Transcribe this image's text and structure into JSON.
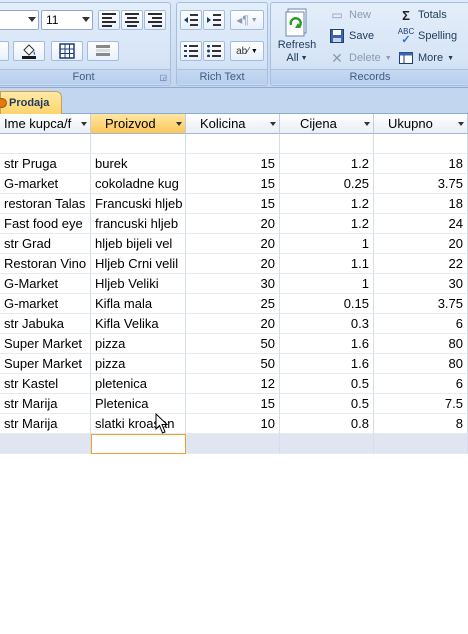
{
  "ribbon": {
    "font_group": {
      "label": "Font",
      "font_size": "11"
    },
    "rich_text_group": {
      "label": "Rich Text"
    },
    "records_group": {
      "label": "Records",
      "refresh_label_line1": "Refresh",
      "refresh_label_line2": "All",
      "new_label": "New",
      "save_label": "Save",
      "delete_label": "Delete",
      "totals_label": "Totals",
      "spelling_label": "Spelling",
      "more_label": "More"
    }
  },
  "tab": {
    "label": "Prodaja"
  },
  "table": {
    "columns": [
      "Ime kupca/f",
      "Proizvod",
      "Kolicina",
      "Cijena",
      "Ukupno"
    ],
    "rows": [
      [
        "str Pruga",
        "burek",
        "15",
        "1.2",
        "18"
      ],
      [
        "G-market",
        "cokoladne kug",
        "15",
        "0.25",
        "3.75"
      ],
      [
        "restoran Talas",
        "Francuski hljeb",
        "15",
        "1.2",
        "18"
      ],
      [
        "Fast food eye",
        "francuski hljeb",
        "20",
        "1.2",
        "24"
      ],
      [
        "str Grad",
        "hljeb bijeli vel",
        "20",
        "1",
        "20"
      ],
      [
        "Restoran Vino",
        "Hljeb Crni velil",
        "20",
        "1.1",
        "22"
      ],
      [
        "G-Market",
        "Hljeb Veliki",
        "30",
        "1",
        "30"
      ],
      [
        "G-market",
        "Kifla mala",
        "25",
        "0.15",
        "3.75"
      ],
      [
        "str Jabuka",
        "Kifla Velika",
        "20",
        "0.3",
        "6"
      ],
      [
        "Super Market",
        "pizza",
        "50",
        "1.6",
        "80"
      ],
      [
        "Super Market",
        "pizza",
        "50",
        "1.6",
        "80"
      ],
      [
        "str Kastel",
        "pletenica",
        "12",
        "0.5",
        "6"
      ],
      [
        "str Marija",
        "Pletenica",
        "15",
        "0.5",
        "7.5"
      ],
      [
        "str Marija",
        "slatki kroasan",
        "10",
        "0.8",
        "8"
      ]
    ]
  },
  "colors": {
    "ribbon_bg": "#cfdff3",
    "tab_accent": "#ffd46b",
    "selected_header": "#fcc75a"
  }
}
